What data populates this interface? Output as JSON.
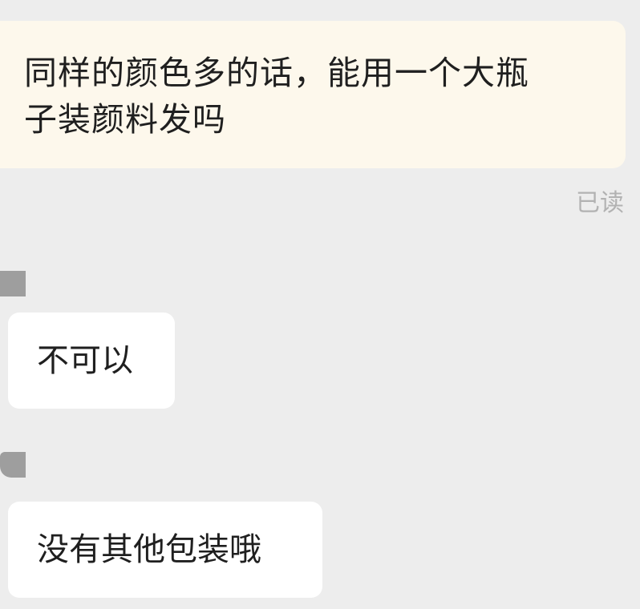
{
  "messages": {
    "sent": {
      "line1": "同样的颜色多的话，能用一个大瓶",
      "line2": "子装颜料发吗",
      "status": "已读"
    },
    "received": [
      {
        "text": "不可以"
      },
      {
        "text": "没有其他包装哦"
      }
    ]
  },
  "colors": {
    "background": "#ededed",
    "sent_bubble": "#fdf8ec",
    "received_bubble": "#ffffff",
    "read_receipt": "#b2b2b2"
  }
}
